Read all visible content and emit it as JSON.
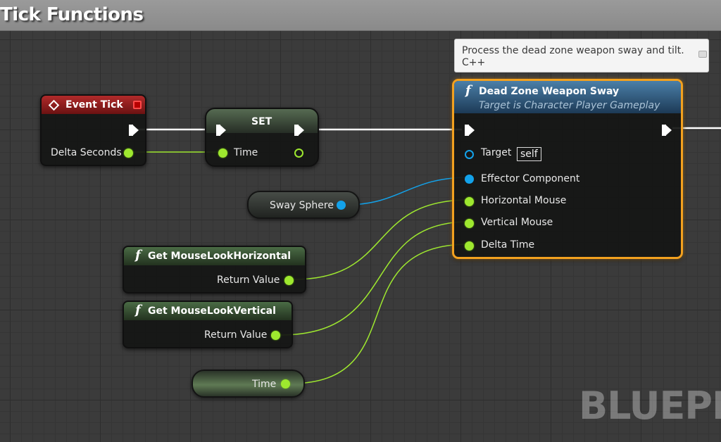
{
  "comment": {
    "title": "Tick Functions"
  },
  "tooltip": {
    "line1": "Process the dead zone weapon sway and tilt.",
    "line2": "C++"
  },
  "event_tick": {
    "title": "Event Tick",
    "pin_delta": "Delta Seconds"
  },
  "set_node": {
    "title": "SET",
    "pin_time": "Time"
  },
  "sway_sphere": {
    "label": "Sway Sphere"
  },
  "get_horizontal": {
    "title": "Get MouseLookHorizontal",
    "return_value": "Return Value"
  },
  "get_vertical": {
    "title": "Get MouseLookVertical",
    "return_value": "Return Value"
  },
  "time_var": {
    "label": "Time"
  },
  "dead_zone": {
    "title": "Dead Zone Weapon Sway",
    "subtitle": "Target is Character Player Gameplay",
    "pin_target": "Target",
    "target_default": "self",
    "pin_effector": "Effector Component",
    "pin_horizontal": "Horizontal Mouse",
    "pin_vertical": "Vertical Mouse",
    "pin_delta": "Delta Time"
  },
  "watermark": "BLUEPR",
  "colors": {
    "exec_wire": "#ffffff",
    "float_pin": "#9ee82f",
    "object_pin": "#13a2ea",
    "selected_outline": "#f3a11f",
    "event_header": "#b22a2a",
    "function_header": "#4b7fa8"
  }
}
